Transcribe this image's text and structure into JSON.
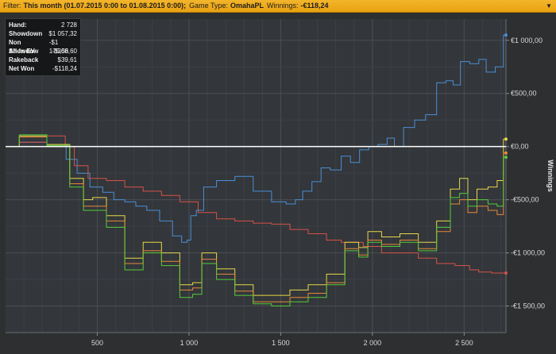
{
  "filter_bar": {
    "filter_label": "Filter:",
    "filter_value": "This month (01.07.2015 0:00 to 01.08.2015 0:00);",
    "game_type_label": "Game Type:",
    "game_type_value": "OmahaPL",
    "winnings_label": "Winnings:",
    "winnings_value": "-€118,24",
    "collapse_icon": "chevron-down-icon"
  },
  "stats": [
    {
      "label": "Hand:",
      "value": "2 728"
    },
    {
      "label": "Showdown",
      "value": "$1 057,32"
    },
    {
      "label": "Non Showdow",
      "value": "-$1 175,56"
    },
    {
      "label": "All-In EV",
      "value": "-$308,60"
    },
    {
      "label": "Rakeback",
      "value": "$39,61"
    },
    {
      "label": "Net Won",
      "value": "-$118,24"
    }
  ],
  "chart_data": {
    "type": "line",
    "ylabel": "Winnings",
    "xlabel": "",
    "xlim": [
      0,
      2728
    ],
    "ylim": [
      -1750,
      1200
    ],
    "x_ticks": [
      500,
      1000,
      1500,
      2000,
      2500
    ],
    "x_tick_labels": [
      "500",
      "1 000",
      "1 500",
      "2 000",
      "2 500"
    ],
    "y_ticks": [
      1000,
      500,
      0,
      -500,
      -1000,
      -1500
    ],
    "y_tick_labels": [
      "€1 000,00",
      "€500,00",
      "€0,00",
      "-€500,00",
      "-€1 000,00",
      "-€1 500,00"
    ],
    "zero_line": 0,
    "grid": true,
    "series": [
      {
        "color": "#4a8fd6",
        "x": [
          0,
          150,
          300,
          360,
          420,
          500,
          560,
          620,
          680,
          740,
          800,
          880,
          940,
          980,
          1000,
          1020,
          1060,
          1100,
          1200,
          1300,
          1400,
          1500,
          1560,
          1600,
          1640,
          1700,
          1740,
          1800,
          1860,
          1900,
          1960,
          2000,
          2060,
          2100,
          2140,
          2200,
          2260,
          2320,
          2380,
          2420,
          2460,
          2500,
          2560,
          2600,
          2640,
          2700,
          2728
        ],
        "y": [
          0,
          40,
          20,
          -120,
          -250,
          -380,
          -430,
          -500,
          -520,
          -560,
          -600,
          -700,
          -840,
          -900,
          -880,
          -650,
          -600,
          -380,
          -320,
          -280,
          -420,
          -520,
          -540,
          -500,
          -420,
          -330,
          -200,
          -220,
          -90,
          -150,
          -30,
          0,
          20,
          80,
          0,
          180,
          250,
          300,
          600,
          620,
          580,
          800,
          780,
          820,
          700,
          750,
          1050
        ]
      },
      {
        "color": "#d6524a",
        "x": [
          0,
          150,
          300,
          350,
          400,
          500,
          600,
          700,
          800,
          900,
          1000,
          1100,
          1200,
          1300,
          1400,
          1500,
          1600,
          1700,
          1800,
          1860,
          1900,
          2000,
          2100,
          2200,
          2300,
          2400,
          2500,
          2560,
          2600,
          2700,
          2728
        ],
        "y": [
          0,
          40,
          100,
          0,
          -180,
          -300,
          -320,
          -380,
          -420,
          -460,
          -520,
          -620,
          -680,
          -700,
          -720,
          -730,
          -780,
          -820,
          -880,
          -900,
          -900,
          -940,
          -1000,
          -1000,
          -1050,
          -1100,
          -1120,
          -1160,
          -1180,
          -1190,
          -1190
        ]
      },
      {
        "color": "#e6d84a",
        "x": [
          0,
          150,
          300,
          400,
          450,
          500,
          600,
          700,
          800,
          900,
          1000,
          1040,
          1100,
          1200,
          1300,
          1400,
          1500,
          1600,
          1700,
          1800,
          1900,
          1950,
          2000,
          2100,
          2200,
          2300,
          2400,
          2450,
          2500,
          2540,
          2600,
          2660,
          2700,
          2728
        ],
        "y": [
          0,
          100,
          20,
          -300,
          -500,
          -480,
          -650,
          -1050,
          -900,
          -1000,
          -1300,
          -1280,
          -1000,
          -1150,
          -1300,
          -1400,
          -1400,
          -1350,
          -1300,
          -1200,
          -900,
          -950,
          -800,
          -850,
          -820,
          -900,
          -700,
          -400,
          -300,
          -500,
          -400,
          -380,
          -320,
          70
        ]
      },
      {
        "color": "#e6893a",
        "x": [
          0,
          150,
          300,
          400,
          450,
          500,
          600,
          700,
          800,
          900,
          1000,
          1040,
          1100,
          1200,
          1300,
          1400,
          1500,
          1600,
          1700,
          1800,
          1900,
          1950,
          2000,
          2100,
          2200,
          2300,
          2400,
          2450,
          2500,
          2540,
          2600,
          2660,
          2700,
          2728
        ],
        "y": [
          0,
          90,
          0,
          -350,
          -560,
          -560,
          -700,
          -1100,
          -980,
          -1080,
          -1350,
          -1330,
          -1060,
          -1200,
          -1360,
          -1460,
          -1460,
          -1420,
          -1380,
          -1280,
          -960,
          -1020,
          -880,
          -920,
          -880,
          -960,
          -800,
          -540,
          -500,
          -620,
          -560,
          -600,
          -640,
          -60
        ]
      },
      {
        "color": "#55cc3a",
        "x": [
          0,
          150,
          300,
          400,
          450,
          500,
          600,
          700,
          800,
          900,
          1000,
          1040,
          1100,
          1200,
          1300,
          1400,
          1500,
          1600,
          1700,
          1800,
          1900,
          1950,
          2000,
          2100,
          2200,
          2300,
          2400,
          2450,
          2500,
          2540,
          2600,
          2660,
          2700,
          2728
        ],
        "y": [
          0,
          110,
          10,
          -380,
          -600,
          -600,
          -760,
          -1160,
          -1000,
          -1120,
          -1420,
          -1390,
          -1100,
          -1250,
          -1400,
          -1480,
          -1500,
          -1460,
          -1420,
          -1300,
          -980,
          -1040,
          -900,
          -940,
          -900,
          -980,
          -760,
          -480,
          -440,
          -560,
          -500,
          -540,
          -560,
          -100
        ]
      }
    ]
  }
}
